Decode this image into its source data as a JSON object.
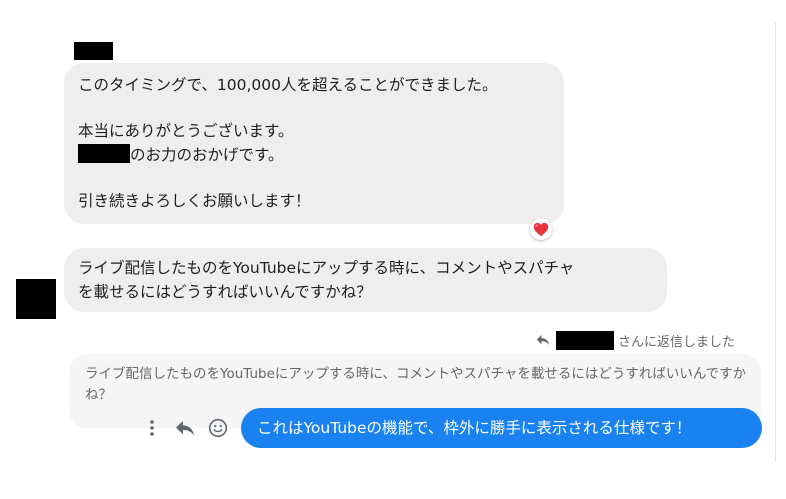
{
  "thread": {
    "incoming_message_1": {
      "line1": "このタイミングで、100,000人を超えることができました。",
      "line2": "本当にありがとうございます。",
      "line3_suffix": "のお力のおかげです。",
      "line4": "引き続きよろしくお願いします！",
      "reaction": "heart-reaction"
    },
    "incoming_message_2": {
      "line1": "ライブ配信したものをYouTubeにアップする時に、コメントやスパチャ",
      "line2": "を載せるにはどうすればいいんですかね？"
    },
    "reply_note": {
      "suffix": "さんに返信しました"
    },
    "quoted_message": {
      "text": "ライブ配信したものをYouTubeにアップする時に、コメントやスパチャを載せるにはどうすればいいんですかね？"
    },
    "outgoing_message": {
      "text": "これはYouTubeの機能で、枠外に勝手に表示される仕様です！"
    }
  },
  "icons": {
    "more": "more-vertical-icon",
    "reply": "reply-icon",
    "react": "smiley-icon",
    "reaction": "heart-icon"
  },
  "colors": {
    "outgoing_bubble": "#1982f0",
    "incoming_bubble": "#eeeeee",
    "quoted_bubble": "#f5f5f5",
    "heart": "#e8323c",
    "meta_text": "#65676b"
  }
}
